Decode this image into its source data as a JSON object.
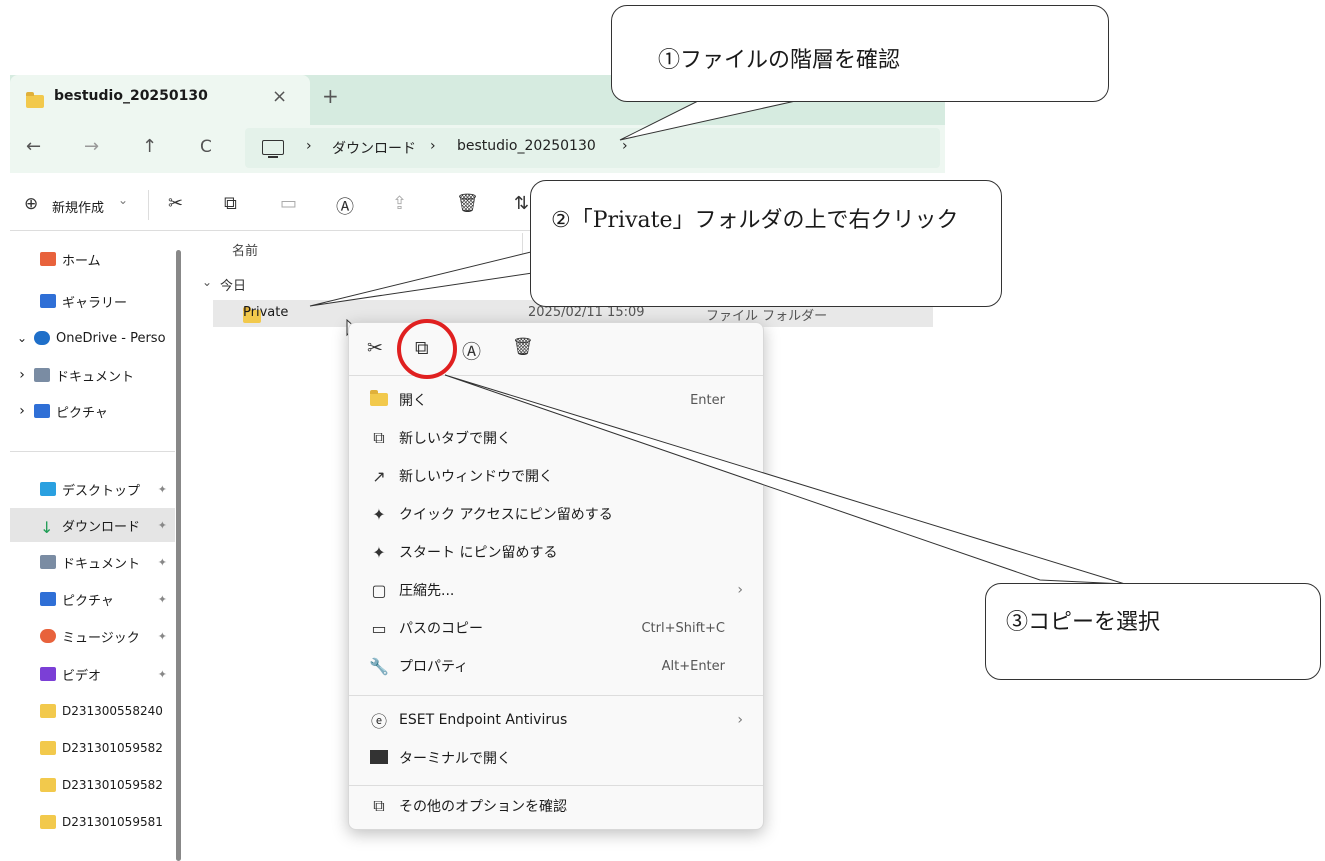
{
  "tab": {
    "title": "bestudio_20250130",
    "close": "×",
    "new": "+"
  },
  "nav": {
    "back": "←",
    "forward": "→",
    "up": "↑",
    "refresh": "C",
    "sep": "›",
    "crumbs": [
      "ダウンロード",
      "bestudio_20250130"
    ]
  },
  "toolbar": {
    "new_label": "新規作成",
    "new_chevron": "⌄"
  },
  "content": {
    "col_name": "名前",
    "group_today": "今日",
    "group_chevron": "⌄",
    "row": {
      "name": "Private",
      "date": "2025/02/11 15:09",
      "type": "ファイル フォルダー"
    }
  },
  "sidebar": {
    "items": [
      {
        "label": "ホーム",
        "color": "#e8623c"
      },
      {
        "label": "ギャラリー",
        "color": "#2f6fd6"
      },
      {
        "label": "OneDrive - Perso",
        "color": "#1f6fc9",
        "exp": "⌄"
      },
      {
        "label": "ドキュメント",
        "color": "#7a8ca3",
        "exp": "›"
      },
      {
        "label": "ピクチャ",
        "color": "#2f6fd6",
        "exp": "›"
      },
      {
        "label": "デスクトップ",
        "color": "#2aa0e0",
        "pin": "📌"
      },
      {
        "label": "ダウンロード",
        "color": "#1f9d55",
        "pin": "📌",
        "sel": true
      },
      {
        "label": "ドキュメント",
        "color": "#7a8ca3",
        "pin": "📌"
      },
      {
        "label": "ピクチャ",
        "color": "#2f6fd6",
        "pin": "📌"
      },
      {
        "label": "ミュージック",
        "color": "#e8623c",
        "pin": "📌"
      },
      {
        "label": "ビデオ",
        "color": "#7b3fd6",
        "pin": "📌"
      },
      {
        "label": "D231300558240",
        "color": "#f2c94c"
      },
      {
        "label": "D231301059582",
        "color": "#f2c94c"
      },
      {
        "label": "D231301059582",
        "color": "#f2c94c"
      },
      {
        "label": "D231301059581",
        "color": "#f2c94c"
      }
    ]
  },
  "menu": {
    "top_icons": [
      "cut-icon",
      "copy-icon",
      "rename-icon",
      "delete-icon"
    ],
    "items": [
      {
        "label": "開く",
        "shortcut": "Enter",
        "icon": "folder-icon"
      },
      {
        "label": "新しいタブで開く",
        "shortcut": "",
        "icon": "new-tab-icon"
      },
      {
        "label": "新しいウィンドウで開く",
        "shortcut": "",
        "icon": "new-window-icon"
      },
      {
        "label": "クイック アクセスにピン留めする",
        "shortcut": "",
        "icon": "pin-icon"
      },
      {
        "label": "スタート にピン留めする",
        "shortcut": "",
        "icon": "pin-icon"
      },
      {
        "label": "圧縮先...",
        "shortcut": "",
        "icon": "zip-icon",
        "arrow": "›"
      },
      {
        "label": "パスのコピー",
        "shortcut": "Ctrl+Shift+C",
        "icon": "path-copy-icon"
      },
      {
        "label": "プロパティ",
        "shortcut": "Alt+Enter",
        "icon": "wrench-icon"
      },
      {
        "label": "ESET Endpoint Antivirus",
        "shortcut": "",
        "icon": "eset-icon",
        "arrow": "›"
      },
      {
        "label": "ターミナルで開く",
        "shortcut": "",
        "icon": "terminal-icon"
      },
      {
        "label": "その他のオプションを確認",
        "shortcut": "",
        "icon": "more-options-icon"
      }
    ]
  },
  "callouts": {
    "c1": "①ファイルの階層を確認",
    "c2": "②「Private」フォルダの上で右クリック",
    "c3": "③コピーを選択"
  }
}
